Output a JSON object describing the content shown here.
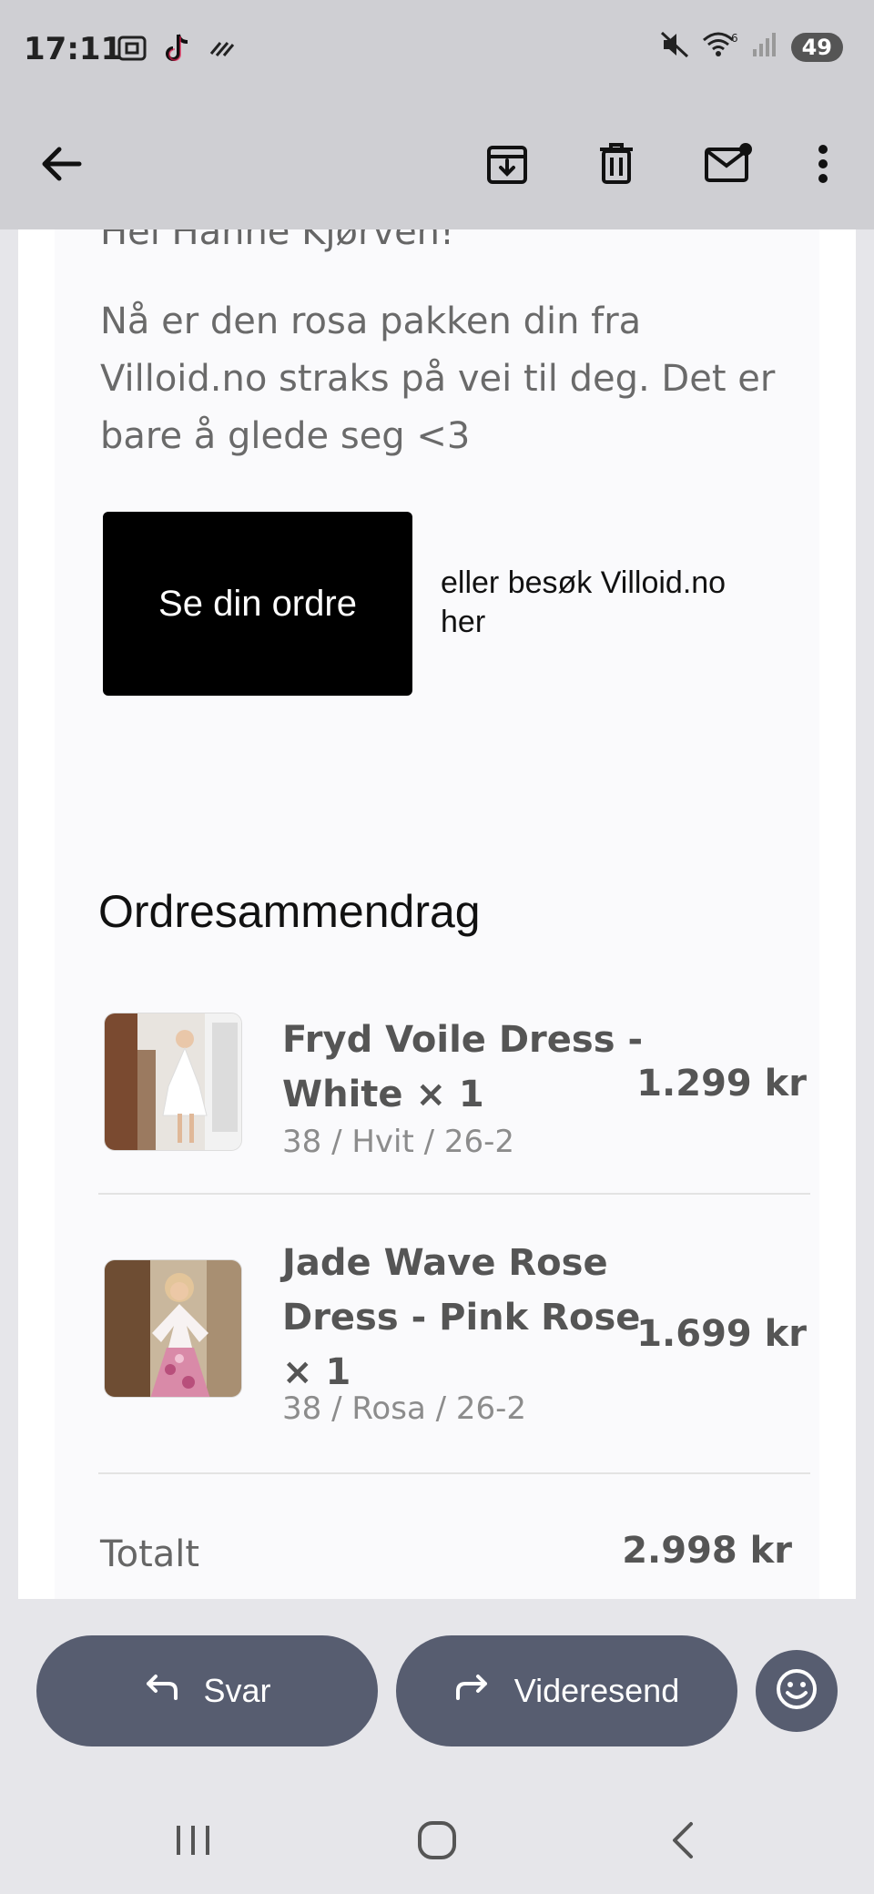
{
  "status_bar": {
    "time": "17:11",
    "battery": "49",
    "network_badge": "6"
  },
  "app_bar": {
    "back_icon": "arrow-left-icon",
    "actions": [
      "archive-icon",
      "trash-icon",
      "mark-unread-icon",
      "more-vert-icon"
    ]
  },
  "email": {
    "greeting": "Hei Hanne Kjørven!",
    "intro": "Nå er den rosa pakken din fra Villoid.no straks på vei til deg. Det er bare å glede seg <3",
    "cta_label": "Se din ordre",
    "visit_text": "eller besøk Villoid.no her",
    "summary_title": "Ordresammendrag",
    "items": [
      {
        "name": "Fryd Voile Dress - White × 1",
        "variant": "38 / Hvit / 26-2",
        "price": "1.299 kr"
      },
      {
        "name": "Jade Wave Rose Dress - Pink Rose × 1",
        "variant": "38 / Rosa / 26-2",
        "price": "1.699 kr"
      }
    ],
    "total_label": "Totalt",
    "total_value": "2.998 kr"
  },
  "actions": {
    "reply_label": "Svar",
    "forward_label": "Videresend"
  },
  "colors": {
    "action_button": "#575d70",
    "cta_background": "#000000",
    "topbar": "#cfcfd3"
  }
}
